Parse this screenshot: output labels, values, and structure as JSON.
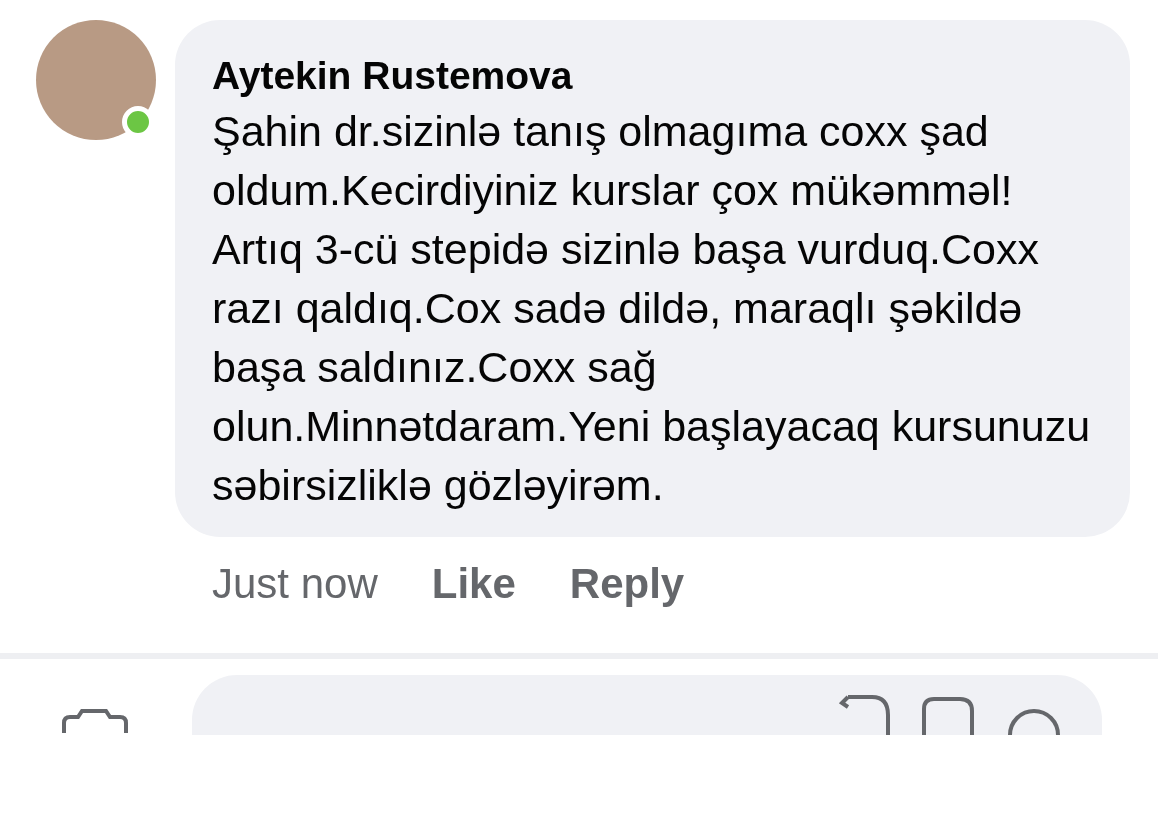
{
  "comment": {
    "author": "Aytekin Rustemova",
    "online": true,
    "text": "Şahin dr.sizinlə tanış olmagıma coxx şad oldum.Kecirdiyiniz kurslar çox mükəmməl! Artıq 3-cü stepidə sizinlə başa vurduq.Coxx razı qaldıq.Cox sadə dildə, maraqlı şəkildə başa saldınız.Coxx sağ olun.Minnətdaram.Yeni başlayacaq kursunuzu səbirsizliklə gözləyirəm.",
    "time": "Just now",
    "actions": [
      "Like",
      "Reply"
    ]
  }
}
